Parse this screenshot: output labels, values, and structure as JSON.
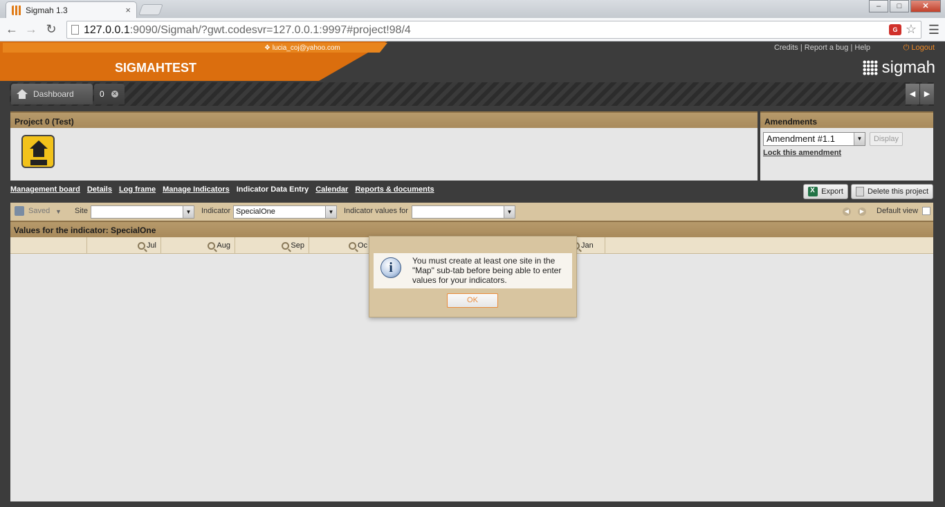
{
  "browser": {
    "tab_title": "Sigmah 1.3",
    "tab_close": "×",
    "url_host": "127.0.0.1",
    "url_rest": ":9090/Sigmah/?gwt.codesvr=127.0.0.1:9997#project!98/4",
    "window_buttons": [
      "–",
      "□",
      "✕"
    ],
    "extension_label": "G"
  },
  "header": {
    "user_email": "❖ lucia_coj@yahoo.com",
    "app_title": "SIGMAHTEST",
    "links": [
      "Credits",
      "Report a bug",
      "Help"
    ],
    "logout": "⏻ Logout",
    "logo_text": "sigmah"
  },
  "tabs": [
    {
      "label": "Dashboard"
    },
    {
      "label": "0"
    }
  ],
  "project_panel": {
    "title": "Project 0 (Test)"
  },
  "amendments": {
    "title": "Amendments",
    "selected": "Amendment #1.1",
    "display_label": "Display",
    "lock_link": "Lock this amendment"
  },
  "subnav": [
    "Management board",
    "Details",
    "Log frame",
    "Manage Indicators",
    "Indicator Data Entry",
    "Calendar",
    "Reports & documents"
  ],
  "actions": {
    "export": "Export",
    "delete": "Delete this project"
  },
  "grid_toolbar": {
    "saved": "Saved",
    "site_label": "Site",
    "site_value": "",
    "indicator_label": "Indicator",
    "indicator_value": "SpecialOne",
    "values_for_label": "Indicator values for",
    "values_for_value": "",
    "default_view": "Default view"
  },
  "values_panel": {
    "title": "Values for the indicator: SpecialOne",
    "columns": [
      "Jul",
      "Aug",
      "Sep",
      "Oc",
      "Jan"
    ]
  },
  "dialog": {
    "message": "You must create at least one site in the \"Map\" sub-tab before being able to enter values for your indicators.",
    "ok": "OK"
  }
}
